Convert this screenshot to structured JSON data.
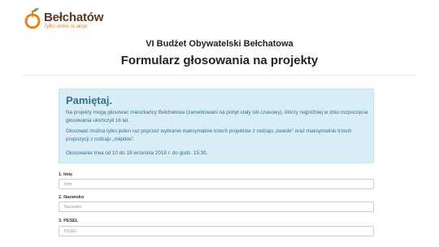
{
  "logo": {
    "name": "Bełchatów",
    "tagline": "Tylko dobre re:akcje"
  },
  "header": {
    "subtitle": "VI Budżet Obywatelski Bełchatowa",
    "title": "Formularz głosowania na projekty"
  },
  "notice": {
    "heading": "Pamiętaj.",
    "paragraph1": "Na projekty mogą głosować mieszkańcy Bełchatowa (zameldowani na pobyt stały lub czasowy), którzy najpóźniej w dniu rozpoczęcia głosowania ukończyli 16 lat.",
    "paragraph2": "Głosować można tylko jeden raz poprzez wybranie maksymalnie trzech projektów z rodzaju „twarde” oraz maksymalnie trzech propozycji z rodzaju „miękkie”.",
    "paragraph3": "Głosowanie trwa od 10 do 18 września 2018 r. do godz. 15:30."
  },
  "form": {
    "fields": [
      {
        "label": "1. Imię",
        "placeholder": "Imię"
      },
      {
        "label": "2. Nazwisko",
        "placeholder": "Nazwisko"
      },
      {
        "label": "3. PESEL",
        "placeholder": "PESEL"
      }
    ]
  },
  "colors": {
    "brand_brown": "#5a3a1e",
    "brand_orange": "#e8821e",
    "brand_green": "#6aa84f",
    "notice_bg": "#d9edf7",
    "notice_text": "#31708f"
  }
}
